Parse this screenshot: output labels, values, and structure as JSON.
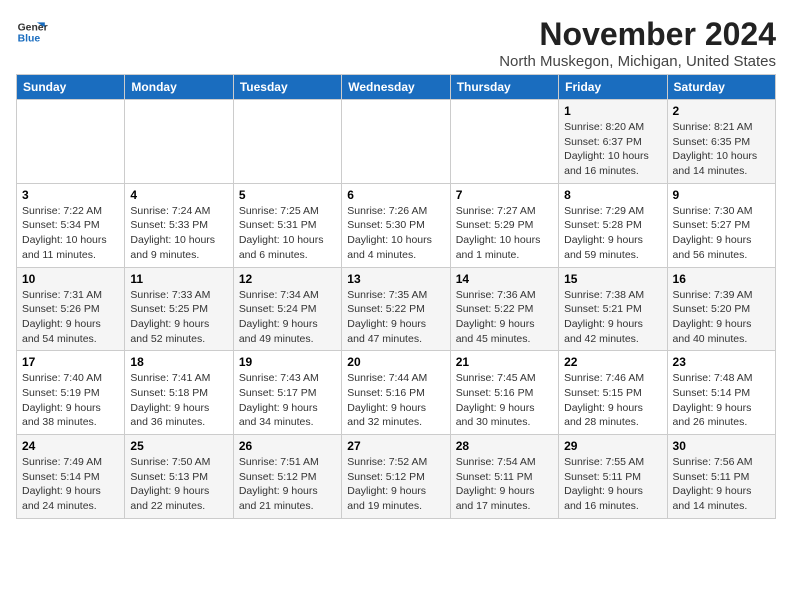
{
  "logo": {
    "line1": "General",
    "line2": "Blue"
  },
  "title": "November 2024",
  "location": "North Muskegon, Michigan, United States",
  "days_of_week": [
    "Sunday",
    "Monday",
    "Tuesday",
    "Wednesday",
    "Thursday",
    "Friday",
    "Saturday"
  ],
  "weeks": [
    [
      {
        "day": "",
        "info": ""
      },
      {
        "day": "",
        "info": ""
      },
      {
        "day": "",
        "info": ""
      },
      {
        "day": "",
        "info": ""
      },
      {
        "day": "",
        "info": ""
      },
      {
        "day": "1",
        "info": "Sunrise: 8:20 AM\nSunset: 6:37 PM\nDaylight: 10 hours and 16 minutes."
      },
      {
        "day": "2",
        "info": "Sunrise: 8:21 AM\nSunset: 6:35 PM\nDaylight: 10 hours and 14 minutes."
      }
    ],
    [
      {
        "day": "3",
        "info": "Sunrise: 7:22 AM\nSunset: 5:34 PM\nDaylight: 10 hours and 11 minutes."
      },
      {
        "day": "4",
        "info": "Sunrise: 7:24 AM\nSunset: 5:33 PM\nDaylight: 10 hours and 9 minutes."
      },
      {
        "day": "5",
        "info": "Sunrise: 7:25 AM\nSunset: 5:31 PM\nDaylight: 10 hours and 6 minutes."
      },
      {
        "day": "6",
        "info": "Sunrise: 7:26 AM\nSunset: 5:30 PM\nDaylight: 10 hours and 4 minutes."
      },
      {
        "day": "7",
        "info": "Sunrise: 7:27 AM\nSunset: 5:29 PM\nDaylight: 10 hours and 1 minute."
      },
      {
        "day": "8",
        "info": "Sunrise: 7:29 AM\nSunset: 5:28 PM\nDaylight: 9 hours and 59 minutes."
      },
      {
        "day": "9",
        "info": "Sunrise: 7:30 AM\nSunset: 5:27 PM\nDaylight: 9 hours and 56 minutes."
      }
    ],
    [
      {
        "day": "10",
        "info": "Sunrise: 7:31 AM\nSunset: 5:26 PM\nDaylight: 9 hours and 54 minutes."
      },
      {
        "day": "11",
        "info": "Sunrise: 7:33 AM\nSunset: 5:25 PM\nDaylight: 9 hours and 52 minutes."
      },
      {
        "day": "12",
        "info": "Sunrise: 7:34 AM\nSunset: 5:24 PM\nDaylight: 9 hours and 49 minutes."
      },
      {
        "day": "13",
        "info": "Sunrise: 7:35 AM\nSunset: 5:22 PM\nDaylight: 9 hours and 47 minutes."
      },
      {
        "day": "14",
        "info": "Sunrise: 7:36 AM\nSunset: 5:22 PM\nDaylight: 9 hours and 45 minutes."
      },
      {
        "day": "15",
        "info": "Sunrise: 7:38 AM\nSunset: 5:21 PM\nDaylight: 9 hours and 42 minutes."
      },
      {
        "day": "16",
        "info": "Sunrise: 7:39 AM\nSunset: 5:20 PM\nDaylight: 9 hours and 40 minutes."
      }
    ],
    [
      {
        "day": "17",
        "info": "Sunrise: 7:40 AM\nSunset: 5:19 PM\nDaylight: 9 hours and 38 minutes."
      },
      {
        "day": "18",
        "info": "Sunrise: 7:41 AM\nSunset: 5:18 PM\nDaylight: 9 hours and 36 minutes."
      },
      {
        "day": "19",
        "info": "Sunrise: 7:43 AM\nSunset: 5:17 PM\nDaylight: 9 hours and 34 minutes."
      },
      {
        "day": "20",
        "info": "Sunrise: 7:44 AM\nSunset: 5:16 PM\nDaylight: 9 hours and 32 minutes."
      },
      {
        "day": "21",
        "info": "Sunrise: 7:45 AM\nSunset: 5:16 PM\nDaylight: 9 hours and 30 minutes."
      },
      {
        "day": "22",
        "info": "Sunrise: 7:46 AM\nSunset: 5:15 PM\nDaylight: 9 hours and 28 minutes."
      },
      {
        "day": "23",
        "info": "Sunrise: 7:48 AM\nSunset: 5:14 PM\nDaylight: 9 hours and 26 minutes."
      }
    ],
    [
      {
        "day": "24",
        "info": "Sunrise: 7:49 AM\nSunset: 5:14 PM\nDaylight: 9 hours and 24 minutes."
      },
      {
        "day": "25",
        "info": "Sunrise: 7:50 AM\nSunset: 5:13 PM\nDaylight: 9 hours and 22 minutes."
      },
      {
        "day": "26",
        "info": "Sunrise: 7:51 AM\nSunset: 5:12 PM\nDaylight: 9 hours and 21 minutes."
      },
      {
        "day": "27",
        "info": "Sunrise: 7:52 AM\nSunset: 5:12 PM\nDaylight: 9 hours and 19 minutes."
      },
      {
        "day": "28",
        "info": "Sunrise: 7:54 AM\nSunset: 5:11 PM\nDaylight: 9 hours and 17 minutes."
      },
      {
        "day": "29",
        "info": "Sunrise: 7:55 AM\nSunset: 5:11 PM\nDaylight: 9 hours and 16 minutes."
      },
      {
        "day": "30",
        "info": "Sunrise: 7:56 AM\nSunset: 5:11 PM\nDaylight: 9 hours and 14 minutes."
      }
    ]
  ]
}
